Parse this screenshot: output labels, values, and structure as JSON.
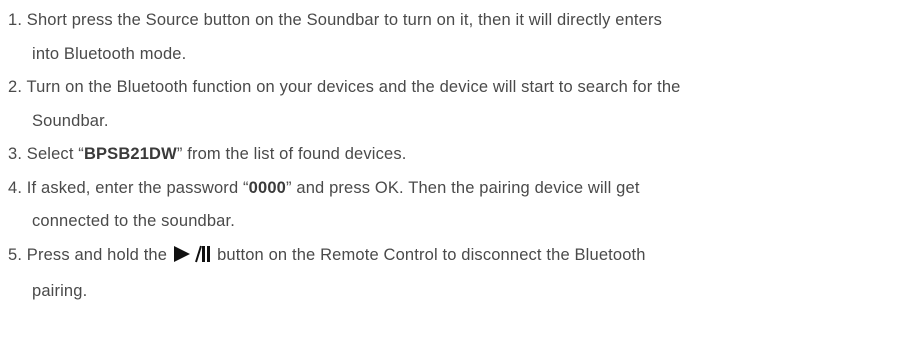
{
  "steps": [
    {
      "number": "1.",
      "line1": "Short press the Source button on the Soundbar to turn on it, then it will directly enters",
      "line2": "into Bluetooth mode."
    },
    {
      "number": "2.",
      "line1": "Turn on the Bluetooth function on your devices and the device will start to search for the",
      "line2": "Soundbar."
    },
    {
      "number": "3.",
      "before": "Select “",
      "bold": "BPSB21DW",
      "after": "” from the list of found devices."
    },
    {
      "number": "4.",
      "before": "If asked, enter the password “",
      "bold": "0000",
      "after": "” and press OK. Then the pairing device will get",
      "line2": "connected to the soundbar."
    },
    {
      "number": "5.",
      "before": "Press and hold the",
      "icon": "play-pause-icon",
      "after": "button on the Remote Control to disconnect the Bluetooth",
      "line2": "pairing."
    }
  ]
}
